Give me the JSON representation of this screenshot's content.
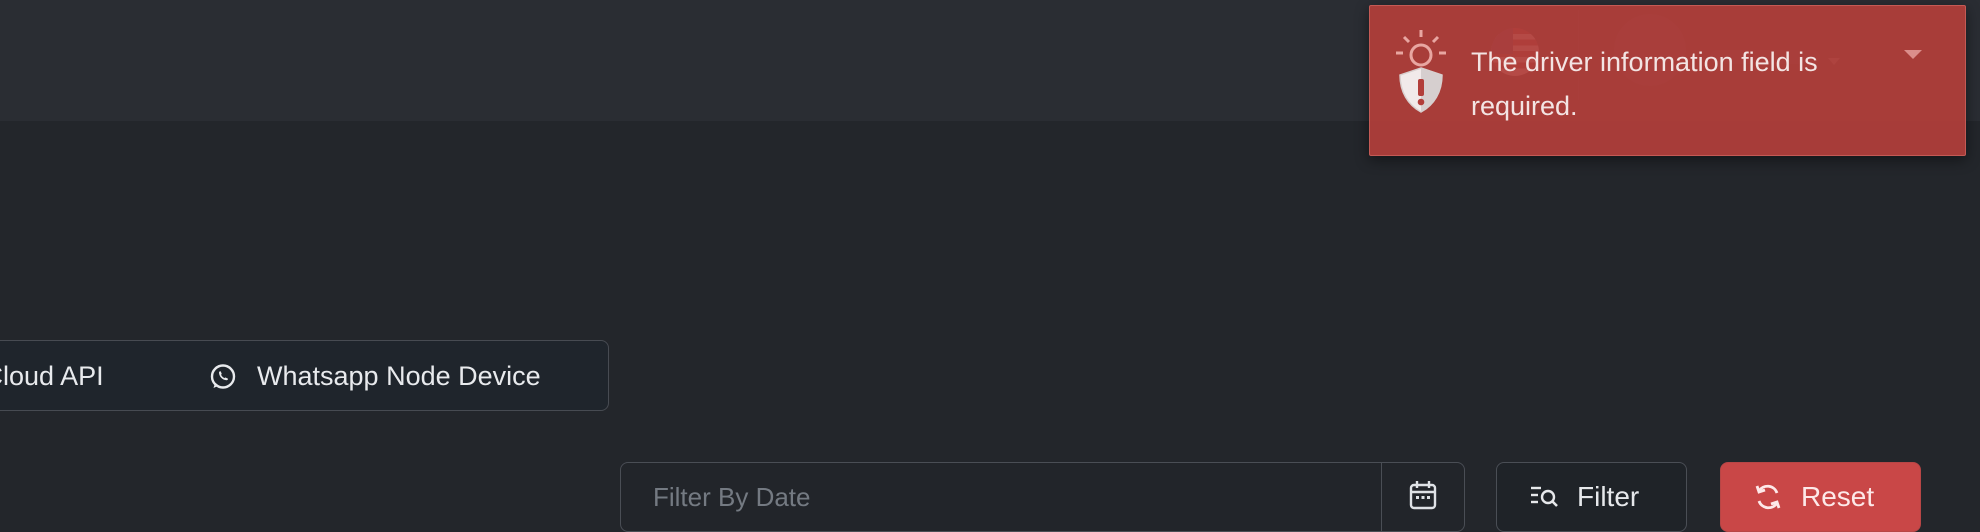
{
  "header": {
    "language_flag": "us-flag-icon"
  },
  "channels": {
    "tabs": [
      {
        "label": "p Cloud API"
      },
      {
        "label": "Whatsapp Node Device",
        "icon": "whatsapp-icon"
      }
    ]
  },
  "filters": {
    "date_placeholder": "Filter By Date",
    "filter_label": "Filter",
    "reset_label": "Reset"
  },
  "toast": {
    "message": "The driver information field is required.",
    "icon": "shield-alert-icon",
    "type": "error",
    "color": "#b23e3a"
  },
  "colors": {
    "background": "#23262b",
    "topbar": "#2a2d33",
    "danger": "#c94747"
  }
}
